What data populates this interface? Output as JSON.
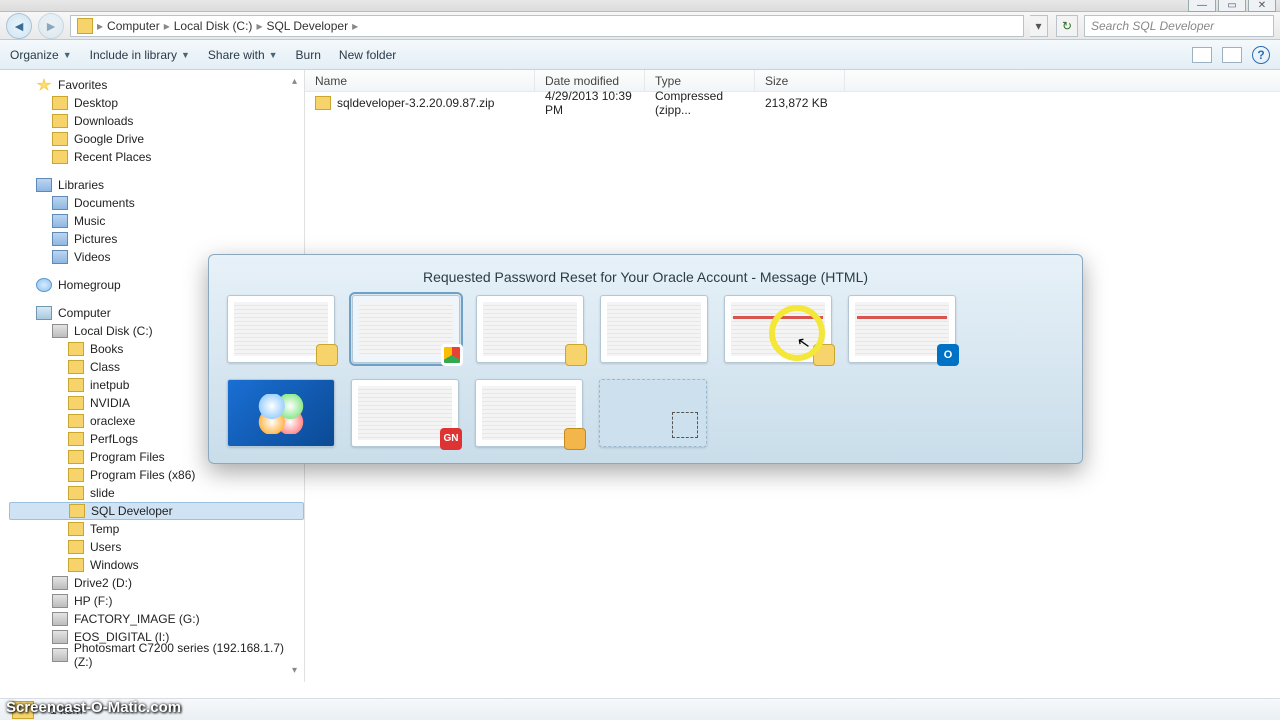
{
  "breadcrumb": {
    "root": "Computer",
    "p1": "Local Disk (C:)",
    "p2": "SQL Developer"
  },
  "search": {
    "placeholder": "Search SQL Developer"
  },
  "toolbar": {
    "organize": "Organize",
    "include": "Include in library",
    "share": "Share with",
    "burn": "Burn",
    "newfolder": "New folder"
  },
  "columns": {
    "name": "Name",
    "modified": "Date modified",
    "type": "Type",
    "size": "Size"
  },
  "file": {
    "name": "sqldeveloper-3.2.20.09.87.zip",
    "modified": "4/29/2013 10:39 PM",
    "type": "Compressed (zipp...",
    "size": "213,872 KB"
  },
  "nav": {
    "favorites": "Favorites",
    "desktop": "Desktop",
    "downloads": "Downloads",
    "gdrive": "Google Drive",
    "recent": "Recent Places",
    "libraries": "Libraries",
    "documents": "Documents",
    "music": "Music",
    "pictures": "Pictures",
    "videos": "Videos",
    "homegroup": "Homegroup",
    "computer": "Computer",
    "c": "Local Disk (C:)",
    "books": "Books",
    "class": "Class",
    "inetpub": "inetpub",
    "nvidia": "NVIDIA",
    "oraclexe": "oraclexe",
    "perflogs": "PerfLogs",
    "pf": "Program Files",
    "pf86": "Program Files (x86)",
    "slide": "slide",
    "sqldev": "SQL Developer",
    "temp": "Temp",
    "users": "Users",
    "windows": "Windows",
    "d": "Drive2 (D:)",
    "f": "HP (F:)",
    "g": "FACTORY_IMAGE (G:)",
    "i": "EOS_DIGITAL (I:)",
    "z": "Photosmart C7200 series (192.168.1.7) (Z:)"
  },
  "status": {
    "count": "1 item"
  },
  "switcher": {
    "title": "Requested Password Reset for Your Oracle Account - Message (HTML)"
  },
  "watermark": "Screencast-O-Matic.com"
}
